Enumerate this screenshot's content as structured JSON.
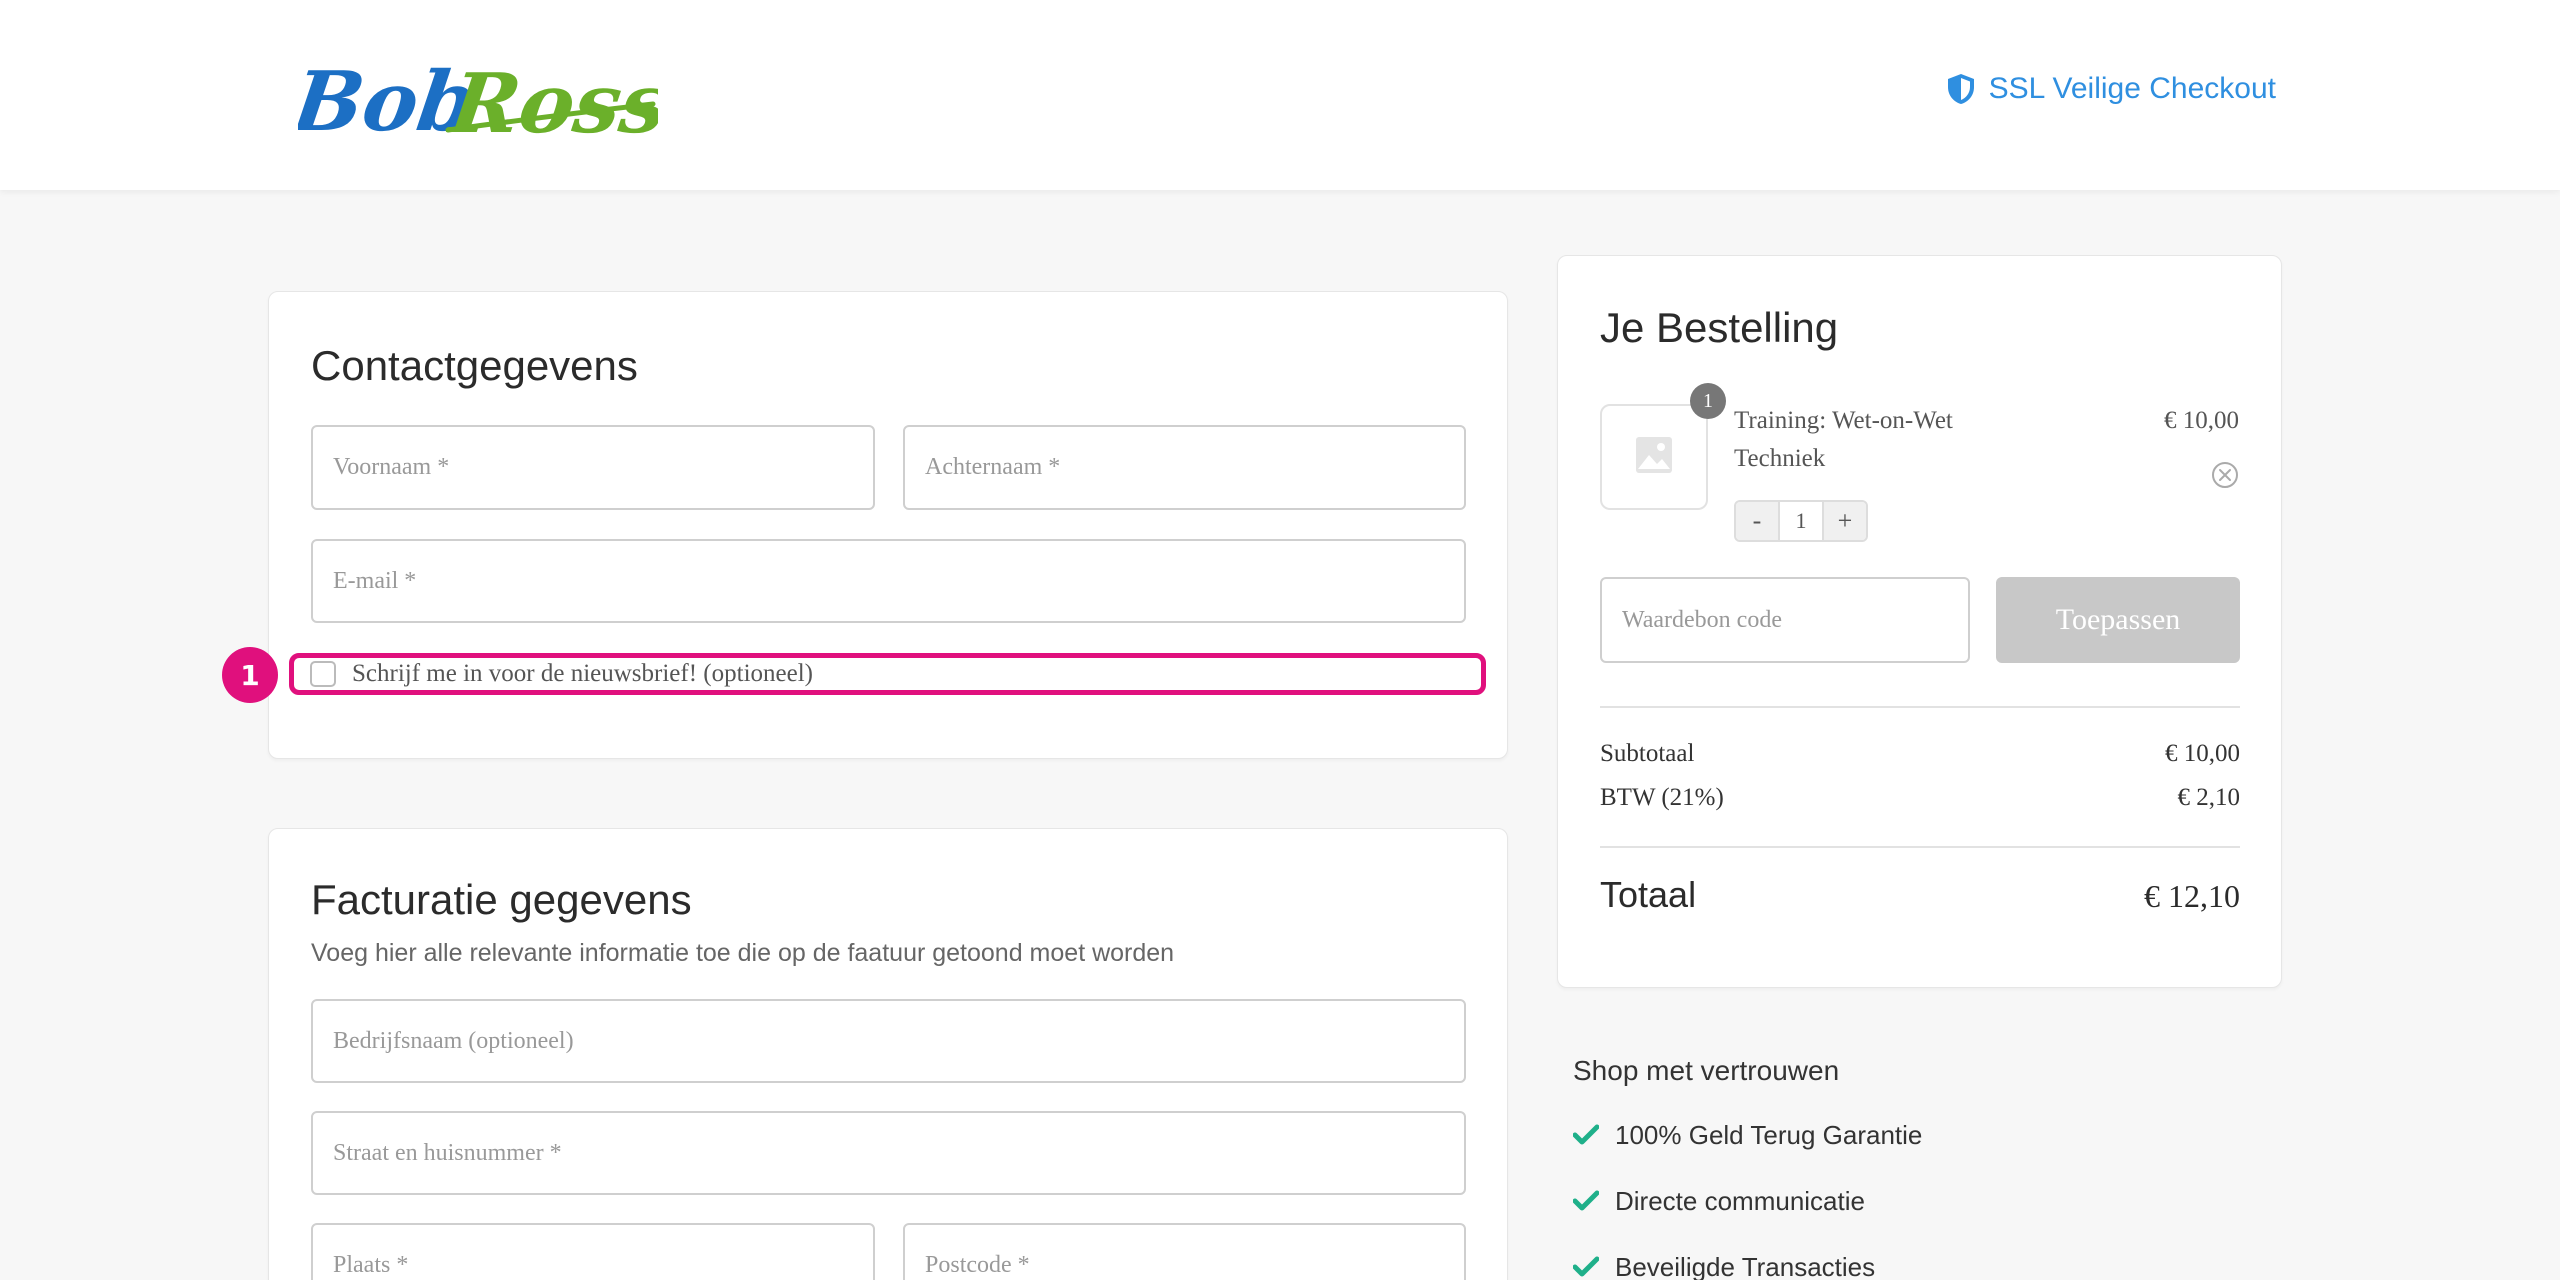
{
  "header": {
    "logo_text": "Bob Ross",
    "ssl_label": "SSL Veilige Checkout",
    "ssl_icon": "shield-icon",
    "link_color": "#2f8fe0"
  },
  "contact": {
    "title": "Contactgegevens",
    "first_name_placeholder": "Voornaam *",
    "last_name_placeholder": "Achternaam *",
    "email_placeholder": "E-mail *",
    "newsletter_label": "Schrijf me in voor de nieuwsbrief! (optioneel)",
    "newsletter_checked": false,
    "highlight_number": "1",
    "highlight_color": "#e0107d"
  },
  "billing": {
    "title": "Facturatie gegevens",
    "subtitle": "Voeg hier alle relevante informatie toe die op de faatuur getoond moet worden",
    "company_placeholder": "Bedrijfsnaam (optioneel)",
    "street_placeholder": "Straat en huisnummer *",
    "city_placeholder": "Plaats *",
    "postcode_placeholder": "Postcode *"
  },
  "order": {
    "title": "Je Bestelling",
    "item": {
      "name": "Training: Wet-on-Wet Techniek",
      "price": "€ 10,00",
      "quantity_badge": "1",
      "quantity": "1",
      "minus_label": "-",
      "plus_label": "+",
      "thumbnail_icon": "image-placeholder-icon"
    },
    "coupon_placeholder": "Waardebon code",
    "apply_label": "Toepassen",
    "subtotal_label": "Subtotaal",
    "subtotal_value": "€ 10,00",
    "vat_label": "BTW (21%)",
    "vat_value": "€ 2,10",
    "total_label": "Totaal",
    "total_value": "€ 12,10"
  },
  "trust": {
    "title": "Shop met vertrouwen",
    "check_color": "#1fb08a",
    "items": [
      "100% Geld Terug Garantie",
      "Directe communicatie",
      "Beveiligde Transacties"
    ]
  }
}
